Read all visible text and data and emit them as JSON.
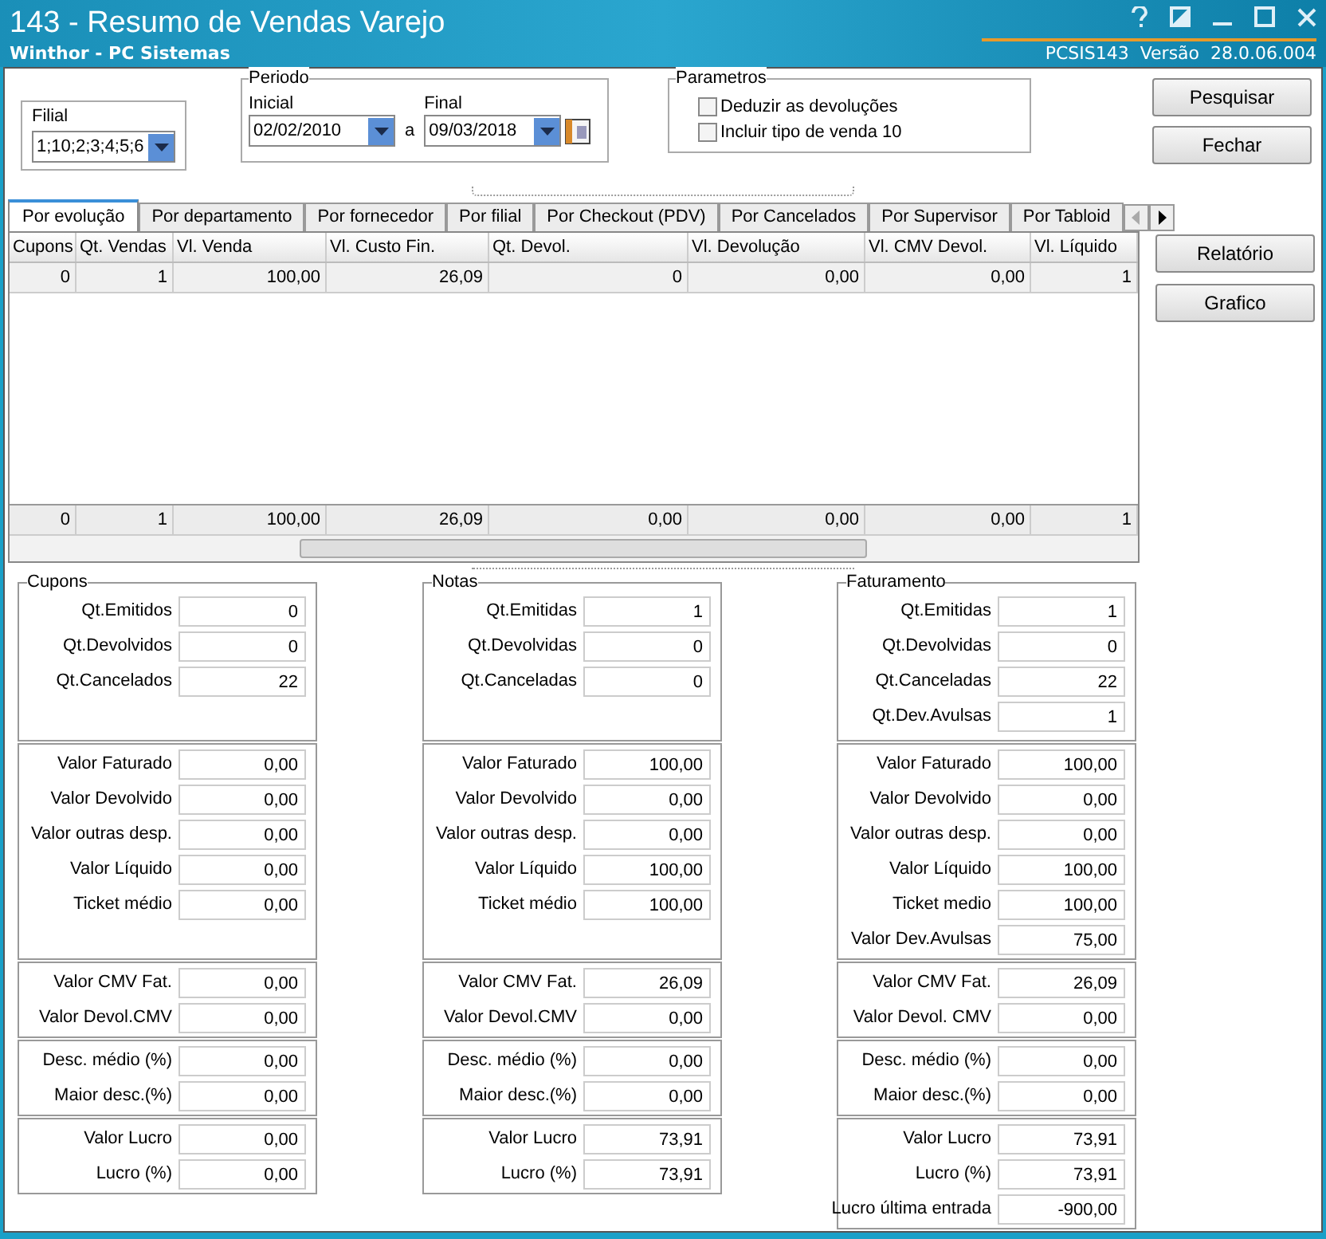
{
  "window": {
    "title": "143 - Resumo de Vendas Varejo",
    "subtitle": "Winthor - PC Sistemas",
    "version": "PCSIS143  Versão  28.0.06.004"
  },
  "filial": {
    "label": "Filial",
    "value": "1;10;2;3;4;5;6"
  },
  "periodo": {
    "title": "Periodo",
    "inicial_label": "Inicial",
    "inicial_value": "02/02/2010",
    "connector": "a",
    "final_label": "Final",
    "final_value": "09/03/2018"
  },
  "parametros": {
    "title": "Parametros",
    "options": [
      {
        "label": "Deduzir as devoluções",
        "checked": false
      },
      {
        "label": "Incluir tipo de venda 10",
        "checked": false
      }
    ]
  },
  "top_buttons": [
    "Pesquisar",
    "Fechar"
  ],
  "side_buttons": [
    "Relatório",
    "Grafico"
  ],
  "tabs": [
    {
      "label": "Por evolução",
      "selected": true
    },
    {
      "label": "Por departamento",
      "selected": false
    },
    {
      "label": "Por fornecedor",
      "selected": false
    },
    {
      "label": "Por filial",
      "selected": false
    },
    {
      "label": "Por Checkout (PDV)",
      "selected": false
    },
    {
      "label": "Por Cancelados",
      "selected": false
    },
    {
      "label": "Por Supervisor",
      "selected": false
    },
    {
      "label": "Por Tabloid",
      "selected": false
    }
  ],
  "table": {
    "columns": [
      "Cupons",
      "Qt. Vendas",
      "Vl. Venda",
      "Vl. Custo Fin.",
      "Qt. Devol.",
      "Vl. Devolução",
      "Vl. CMV Devol.",
      "Vl. Líquido"
    ],
    "rows": [
      [
        "0",
        "1",
        "100,00",
        "26,09",
        "0",
        "0,00",
        "0,00",
        "1"
      ]
    ],
    "totals": [
      "0",
      "1",
      "100,00",
      "26,09",
      "0,00",
      "0,00",
      "0,00",
      "1"
    ]
  },
  "summary": [
    {
      "title": "Cupons",
      "groups": [
        [
          {
            "label": "Qt.Emitidos",
            "value": "0"
          },
          {
            "label": "Qt.Devolvidos",
            "value": "0"
          },
          {
            "label": "Qt.Cancelados",
            "value": "22"
          }
        ],
        [
          {
            "label": "Valor Faturado",
            "value": "0,00"
          },
          {
            "label": "Valor Devolvido",
            "value": "0,00"
          },
          {
            "label": "Valor outras desp.",
            "value": "0,00"
          },
          {
            "label": "Valor Líquido",
            "value": "0,00"
          },
          {
            "label": "Ticket médio",
            "value": "0,00"
          }
        ],
        [
          {
            "label": "Valor CMV Fat.",
            "value": "0,00"
          },
          {
            "label": "Valor Devol.CMV",
            "value": "0,00"
          }
        ],
        [
          {
            "label": "Desc. médio (%)",
            "value": "0,00"
          },
          {
            "label": "Maior desc.(%)",
            "value": "0,00"
          }
        ],
        [
          {
            "label": "Valor Lucro",
            "value": "0,00"
          },
          {
            "label": "Lucro (%)",
            "value": "0,00"
          }
        ]
      ]
    },
    {
      "title": "Notas",
      "groups": [
        [
          {
            "label": "Qt.Emitidas",
            "value": "1"
          },
          {
            "label": "Qt.Devolvidas",
            "value": "0"
          },
          {
            "label": "Qt.Canceladas",
            "value": "0"
          }
        ],
        [
          {
            "label": "Valor Faturado",
            "value": "100,00"
          },
          {
            "label": "Valor Devolvido",
            "value": "0,00"
          },
          {
            "label": "Valor outras desp.",
            "value": "0,00"
          },
          {
            "label": "Valor Líquido",
            "value": "100,00"
          },
          {
            "label": "Ticket médio",
            "value": "100,00"
          }
        ],
        [
          {
            "label": "Valor CMV Fat.",
            "value": "26,09"
          },
          {
            "label": "Valor Devol.CMV",
            "value": "0,00"
          }
        ],
        [
          {
            "label": "Desc. médio (%)",
            "value": "0,00"
          },
          {
            "label": "Maior desc.(%)",
            "value": "0,00"
          }
        ],
        [
          {
            "label": "Valor Lucro",
            "value": "73,91"
          },
          {
            "label": "Lucro (%)",
            "value": "73,91"
          }
        ]
      ]
    },
    {
      "title": "Faturamento",
      "groups": [
        [
          {
            "label": "Qt.Emitidas",
            "value": "1"
          },
          {
            "label": "Qt.Devolvidas",
            "value": "0"
          },
          {
            "label": "Qt.Canceladas",
            "value": "22"
          },
          {
            "label": "Qt.Dev.Avulsas",
            "value": "1"
          }
        ],
        [
          {
            "label": "Valor Faturado",
            "value": "100,00"
          },
          {
            "label": "Valor Devolvido",
            "value": "0,00"
          },
          {
            "label": "Valor outras desp.",
            "value": "0,00"
          },
          {
            "label": "Valor Líquido",
            "value": "100,00"
          },
          {
            "label": "Ticket medio",
            "value": "100,00"
          },
          {
            "label": "Valor Dev.Avulsas",
            "value": "75,00"
          }
        ],
        [
          {
            "label": "Valor CMV Fat.",
            "value": "26,09"
          },
          {
            "label": "Valor Devol. CMV",
            "value": "0,00"
          }
        ],
        [
          {
            "label": "Desc. médio (%)",
            "value": "0,00"
          },
          {
            "label": "Maior desc.(%)",
            "value": "0,00"
          }
        ],
        [
          {
            "label": "Valor Lucro",
            "value": "73,91"
          },
          {
            "label": "Lucro (%)",
            "value": "73,91"
          },
          {
            "label": "Lucro última entrada",
            "value": "-900,00"
          }
        ]
      ]
    }
  ]
}
